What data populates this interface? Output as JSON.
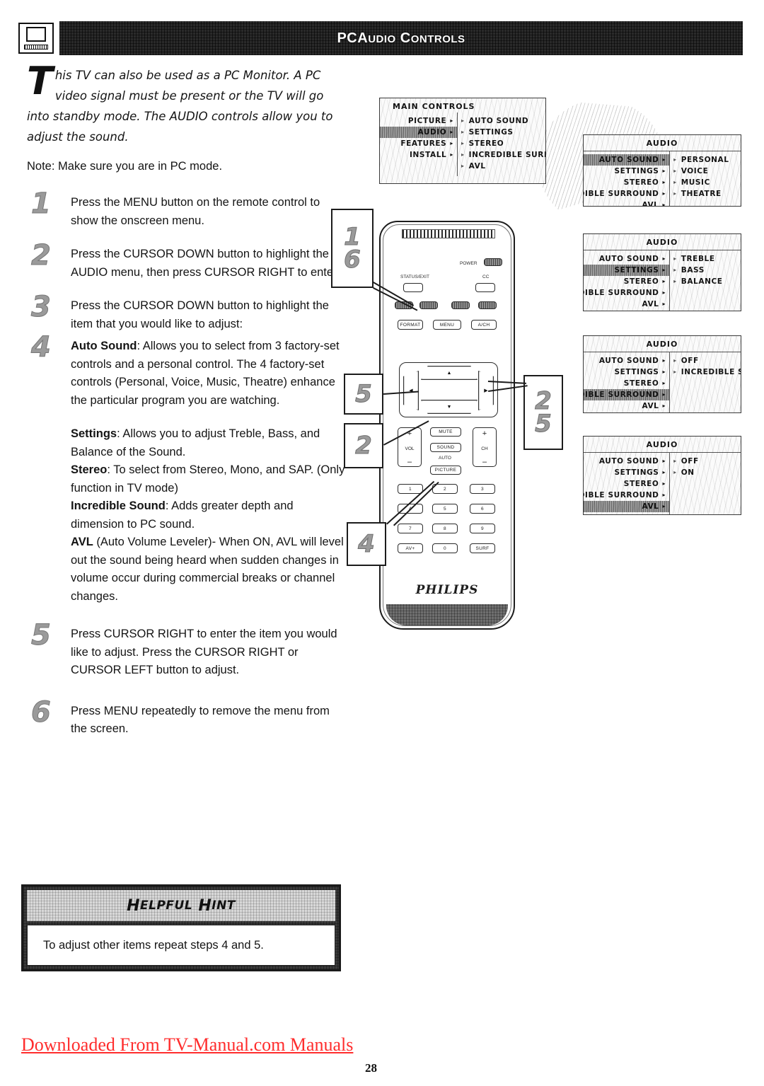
{
  "header": {
    "icon": "pc-monitor-icon",
    "title_main": "PC",
    "title_rest_1": "A",
    "title_rest_1b": "UDIO",
    "title_rest_2": "C",
    "title_rest_2b": "ONTROLS"
  },
  "intro": {
    "dropcap": "T",
    "body": "his TV can also be used as a PC Monitor. A PC video signal must be present or the TV will go into standby mode. The AUDIO controls allow you to adjust the sound.",
    "note": "Note: Make sure you are in PC mode."
  },
  "steps": [
    {
      "num": "1",
      "text": "Press the MENU button on the remote control to show the onscreen menu."
    },
    {
      "num": "2",
      "text": "Press the CURSOR DOWN button to highlight the AUDIO menu, then press CURSOR RIGHT to enter."
    },
    {
      "num": "3",
      "text": "Press the CURSOR DOWN  button to highlight the item that you  would like to adjust:"
    },
    {
      "num": "4",
      "term": "Auto Sound",
      "text": ": Allows you to select from 3 factory-set controls and a personal control. The 4 factory-set controls (Personal, Voice, Music, Theatre) enhance the particular program you are watching."
    },
    {
      "num": "5",
      "text": "Press CURSOR RIGHT to enter the item you would like to adjust. Press the CURSOR RIGHT or CURSOR LEFT button to adjust."
    },
    {
      "num": "6",
      "text": "Press MENU repeatedly to remove the menu from the screen."
    }
  ],
  "definitions": [
    {
      "term": "Settings",
      "text": ": Allows you to adjust Treble, Bass, and Balance of the Sound."
    },
    {
      "term": "Stereo",
      "text": ": To select from Stereo, Mono, and SAP. (Only function in TV mode)"
    },
    {
      "term": "Incredible Sound",
      "text": ": Adds greater depth and dimension to PC sound."
    },
    {
      "term": "AVL",
      "text": " (Auto Volume Leveler)- When ON, AVL will level out the sound being heard when sudden changes in volume occur during commercial breaks or channel changes."
    }
  ],
  "hint": {
    "title_h": "H",
    "title_elpful": "ELPFUL",
    "title_h2": "H",
    "title_int": "INT",
    "body": "To adjust other items repeat steps 4 and 5."
  },
  "footer": {
    "link": "Downloaded From TV-Manual.com Manuals",
    "page": "28"
  },
  "menus": {
    "main": {
      "title": "MAIN CONTROLS",
      "left": [
        {
          "label": "PICTURE",
          "arrow": "▸",
          "highlighted": false
        },
        {
          "label": "AUDIO",
          "arrow": "▸",
          "highlighted": true
        },
        {
          "label": "FEATURES",
          "arrow": "▸",
          "highlighted": false
        },
        {
          "label": "INSTALL",
          "arrow": "▸",
          "highlighted": false
        }
      ],
      "right": [
        {
          "label": "AUTO SOUND",
          "arrow": "▸"
        },
        {
          "label": "SETTINGS",
          "arrow": "▸"
        },
        {
          "label": "STEREO",
          "arrow": "▸"
        },
        {
          "label": "INCREDIBLE SURROUND",
          "arrow": "▸"
        },
        {
          "label": "AVL",
          "arrow": "▸"
        }
      ]
    },
    "audio_panels": [
      {
        "title": "AUDIO",
        "left": [
          {
            "label": "AUTO SOUND",
            "arrow": "▸",
            "highlighted": true
          },
          {
            "label": "SETTINGS",
            "arrow": "▸",
            "highlighted": false
          },
          {
            "label": "STEREO",
            "arrow": "▸",
            "highlighted": false
          },
          {
            "label": "INCREDIBLE SURROUND",
            "arrow": "▸",
            "highlighted": false
          },
          {
            "label": "AVL",
            "arrow": "▸",
            "highlighted": false
          }
        ],
        "right": [
          {
            "label": "PERSONAL",
            "arrow": "▸"
          },
          {
            "label": "VOICE",
            "arrow": "▸"
          },
          {
            "label": "MUSIC",
            "arrow": "▸"
          },
          {
            "label": "THEATRE",
            "arrow": "▸"
          }
        ]
      },
      {
        "title": "AUDIO",
        "left": [
          {
            "label": "AUTO SOUND",
            "arrow": "▸",
            "highlighted": false
          },
          {
            "label": "SETTINGS",
            "arrow": "▸",
            "highlighted": true
          },
          {
            "label": "STEREO",
            "arrow": "▸",
            "highlighted": false
          },
          {
            "label": "INCREDIBLE SURROUND",
            "arrow": "▸",
            "highlighted": false
          },
          {
            "label": "AVL",
            "arrow": "▸",
            "highlighted": false
          }
        ],
        "right": [
          {
            "label": "TREBLE",
            "arrow": "▸"
          },
          {
            "label": "BASS",
            "arrow": "▸"
          },
          {
            "label": "BALANCE",
            "arrow": "▸"
          }
        ]
      },
      {
        "title": "AUDIO",
        "left": [
          {
            "label": "AUTO SOUND",
            "arrow": "▸",
            "highlighted": false
          },
          {
            "label": "SETTINGS",
            "arrow": "▸",
            "highlighted": false
          },
          {
            "label": "STEREO",
            "arrow": "▸",
            "highlighted": false
          },
          {
            "label": "INCREDIBLE SURROUND",
            "arrow": "▸",
            "highlighted": true
          },
          {
            "label": "AVL",
            "arrow": "▸",
            "highlighted": false
          }
        ],
        "right": [
          {
            "label": "OFF",
            "arrow": "▸"
          },
          {
            "label": "INCREDIBLE SURROUND",
            "arrow": "▸"
          }
        ]
      },
      {
        "title": "AUDIO",
        "left": [
          {
            "label": "AUTO SOUND",
            "arrow": "▸",
            "highlighted": false
          },
          {
            "label": "SETTINGS",
            "arrow": "▸",
            "highlighted": false
          },
          {
            "label": "STEREO",
            "arrow": "▸",
            "highlighted": false
          },
          {
            "label": "INCREDIBLE SURROUND",
            "arrow": "▸",
            "highlighted": false
          },
          {
            "label": "AVL",
            "arrow": "▸",
            "highlighted": true
          }
        ],
        "right": [
          {
            "label": "OFF",
            "arrow": "▸"
          },
          {
            "label": "ON",
            "arrow": "▸"
          }
        ]
      }
    ]
  },
  "remote": {
    "brand": "PHILIPS",
    "power_label": "POWER",
    "status_exit_label": "STATUS/EXIT",
    "cc_label": "CC",
    "format_label": "FORMAT",
    "menu_label": "MENU",
    "ach_label": "A/CH",
    "mute_label": "MUTE",
    "sound_label": "SOUND",
    "auto_label": "AUTO",
    "picture_label": "PICTURE",
    "vol_label": "VOL",
    "ch_label": "CH",
    "plus": "+",
    "minus": "–",
    "cursor_up": "▲",
    "cursor_down": "▼",
    "cursor_left": "◀",
    "cursor_right": "▶",
    "keys": [
      "1",
      "2",
      "3",
      "4",
      "5",
      "6",
      "7",
      "8",
      "9",
      "AV+",
      "0",
      "SURF"
    ]
  },
  "callouts": [
    {
      "id": "16",
      "lines": [
        "1",
        "6"
      ]
    },
    {
      "id": "5",
      "lines": [
        "5"
      ]
    },
    {
      "id": "2",
      "lines": [
        "2"
      ]
    },
    {
      "id": "25",
      "lines": [
        "2",
        "5"
      ]
    },
    {
      "id": "4",
      "lines": [
        "4"
      ]
    }
  ]
}
